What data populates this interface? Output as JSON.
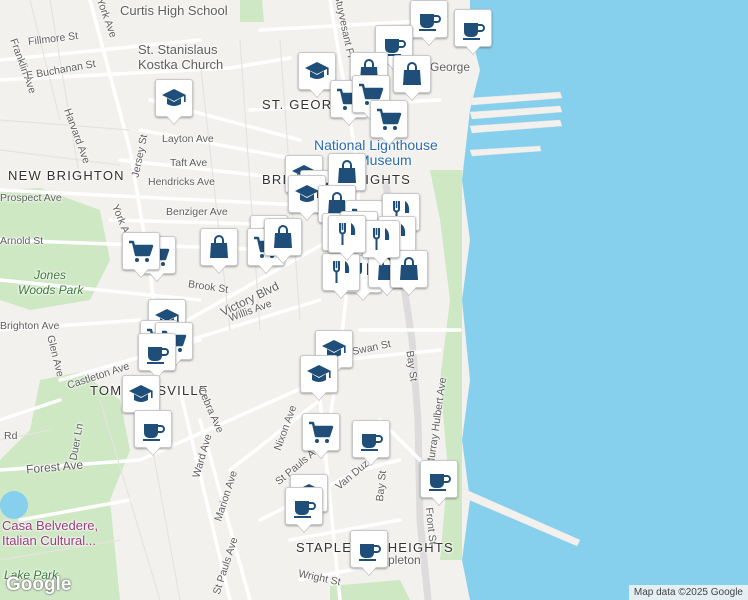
{
  "map": {
    "colors": {
      "water": "#86d0ee",
      "land": "#f3f1ee",
      "park": "#cfe8c4",
      "road": "#ffffff",
      "major_road": "#dcdcdc",
      "marker_icon": "#1f4e79"
    },
    "neighborhoods": {
      "new_brighton": "NEW BRIGHTON",
      "st_george": "ST. GEORGE",
      "tompkinsville": "TOMPKINSVILLE",
      "stapleton_heights": "STAPLETON HEIGHTS",
      "brighton_heights": "BRIGHTON HEIGHTS"
    },
    "pois": {
      "curtis": "Curtis High School",
      "church_line1": "St. Stanislaus",
      "church_line2": "Kostka Church",
      "lighthouse_line1": "National Lighthouse",
      "lighthouse_line2": "Museum",
      "casa_line1": "Casa Belvedere,",
      "casa_line2": "Italian Cultural...",
      "jones_line1": "Jones",
      "jones_line2": "Woods Park",
      "lake_park": "Lake Park",
      "st_george_station": "St. George",
      "stapleton_station": "Stapleton"
    },
    "streets": {
      "fillmore": "Fillmore St",
      "york": "York Ave",
      "franklin": "Franklin Ave",
      "buchanan": "E Buchanan St",
      "harvard": "Harvard Ave",
      "layton": "Layton Ave",
      "taft": "Taft Ave",
      "hendricks": "Hendricks Ave",
      "prospect": "Prospect Ave",
      "benziger": "Benziger Ave",
      "arnold": "Arnold St",
      "jersey": "Jersey St",
      "york2": "York Ave",
      "brook": "Brook St",
      "victory": "Victory Blvd",
      "willis": "Willis Ave",
      "brighton": "Brighton Ave",
      "glen": "Glen Ave",
      "castleton": "Castleton Ave",
      "cebra": "Cebra Ave",
      "ward": "Ward Ave",
      "duer": "Duer Ln",
      "forest": "Forest Ave",
      "marion": "Marion Ave",
      "nixon": "Nixon Ave",
      "st_pauls": "St Pauls Ave",
      "st_pauls2": "St Pauls Ave",
      "bay": "Bay St",
      "bay2": "Bay St",
      "murray": "Murray Hulbert Ave",
      "front": "Front St",
      "wright": "Wright St",
      "van_duzer": "Van Duzer St",
      "swan": "Swan St",
      "stuyvesant": "Stuyvesant Pl",
      "rd": "Rd"
    },
    "markers": [
      {
        "icon": "coffee-icon"
      },
      {
        "icon": "coffee-icon"
      },
      {
        "icon": "coffee-icon"
      },
      {
        "icon": "school-icon"
      },
      {
        "icon": "school-icon"
      },
      {
        "icon": "bag-icon"
      },
      {
        "icon": "bag-icon"
      },
      {
        "icon": "cart-icon"
      },
      {
        "icon": "cart-icon"
      },
      {
        "icon": "cart-icon"
      },
      {
        "icon": "school-icon"
      },
      {
        "icon": "cart-icon"
      },
      {
        "icon": "school-icon"
      },
      {
        "icon": "bag-icon"
      },
      {
        "icon": "school-icon"
      },
      {
        "icon": "bag-icon"
      },
      {
        "icon": "cart-icon"
      },
      {
        "icon": "bag-icon"
      },
      {
        "icon": "cart-icon"
      },
      {
        "icon": "cart-icon"
      },
      {
        "icon": "bag-icon"
      },
      {
        "icon": "cutlery-icon"
      },
      {
        "icon": "cart-icon"
      },
      {
        "icon": "cutlery-icon"
      },
      {
        "icon": "cutlery-icon"
      },
      {
        "icon": "cutlery-icon"
      },
      {
        "icon": "cart-icon"
      },
      {
        "icon": "cutlery-icon"
      },
      {
        "icon": "cutlery-icon"
      },
      {
        "icon": "bag-icon"
      },
      {
        "icon": "bag-icon"
      },
      {
        "icon": "cutlery-icon"
      },
      {
        "icon": "cutlery-icon"
      },
      {
        "icon": "school-icon"
      },
      {
        "icon": "cart-icon"
      },
      {
        "icon": "cart-icon"
      },
      {
        "icon": "coffee-icon"
      },
      {
        "icon": "school-icon"
      },
      {
        "icon": "school-icon"
      },
      {
        "icon": "school-icon"
      },
      {
        "icon": "coffee-icon"
      },
      {
        "icon": "cart-icon"
      },
      {
        "icon": "coffee-icon"
      },
      {
        "icon": "coffee-icon"
      },
      {
        "icon": "school-icon"
      },
      {
        "icon": "coffee-icon"
      },
      {
        "icon": "coffee-icon"
      }
    ],
    "google_logo": "Google",
    "attribution": "Map data ©2025 Google"
  }
}
